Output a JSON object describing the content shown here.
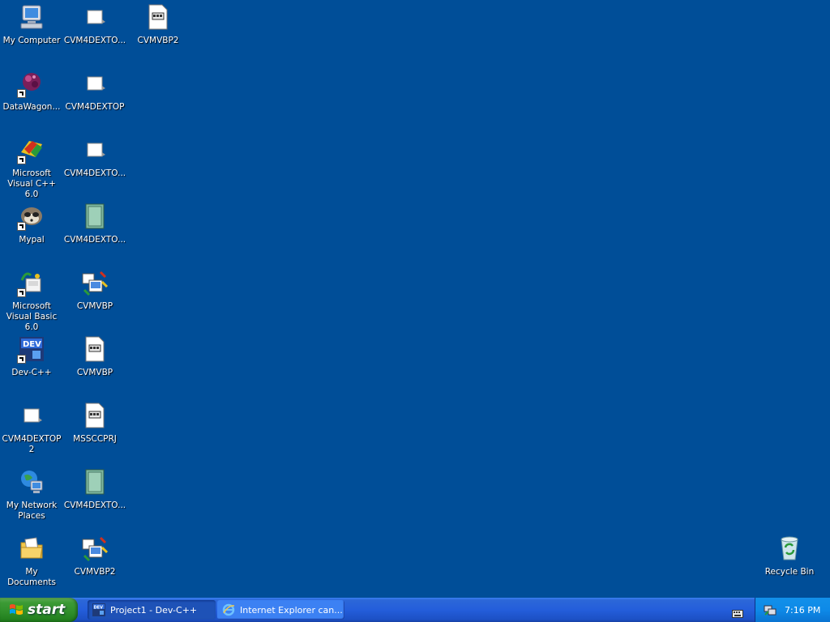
{
  "desktop": {
    "background_color": "#004E98",
    "icons": [
      {
        "label": "My Computer",
        "icon": "my-computer-icon"
      },
      {
        "label": "DataWagon...",
        "icon": "datawagon-icon",
        "shortcut": true
      },
      {
        "label": "Microsoft Visual C++ 6.0",
        "icon": "visual-cpp-icon",
        "shortcut": true
      },
      {
        "label": "Mypal",
        "icon": "mypal-icon",
        "shortcut": true
      },
      {
        "label": "Microsoft Visual Basic 6.0",
        "icon": "visual-basic-icon",
        "shortcut": true
      },
      {
        "label": "Dev-C++",
        "icon": "devcpp-icon",
        "shortcut": true
      },
      {
        "label": "CVM4DEXTOP2",
        "icon": "file-icon"
      },
      {
        "label": "My Network Places",
        "icon": "network-places-icon"
      },
      {
        "label": "My Documents",
        "icon": "my-documents-icon"
      },
      {
        "label": "CVM4DEXTO...",
        "icon": "file-icon"
      },
      {
        "label": "CVM4DEXTOP",
        "icon": "file-icon"
      },
      {
        "label": "CVM4DEXTO...",
        "icon": "file-icon"
      },
      {
        "label": "CVM4DEXTO...",
        "icon": "notebook-icon"
      },
      {
        "label": "CVMVBP",
        "icon": "vb-project-icon"
      },
      {
        "label": "CVMVBP",
        "icon": "vb-document-icon"
      },
      {
        "label": "MSSCCPRJ",
        "icon": "vb-document-icon"
      },
      {
        "label": "CVM4DEXTO...",
        "icon": "notebook-icon"
      },
      {
        "label": "CVMVBP2",
        "icon": "vb-project-icon"
      },
      {
        "label": "CVMVBP2",
        "icon": "vb-document-icon"
      },
      {
        "label": "Recycle Bin",
        "icon": "recycle-bin-icon"
      }
    ]
  },
  "taskbar": {
    "start_label": "start",
    "tasks": [
      {
        "label": "Project1 - Dev-C++",
        "icon": "devcpp-icon",
        "active": true
      },
      {
        "label": "Internet Explorer can...",
        "icon": "internet-explorer-icon",
        "active": false
      }
    ],
    "tray": {
      "clock": "7:16 PM",
      "icons": [
        "network-tray-icon",
        "keyboard-icon"
      ]
    }
  }
}
